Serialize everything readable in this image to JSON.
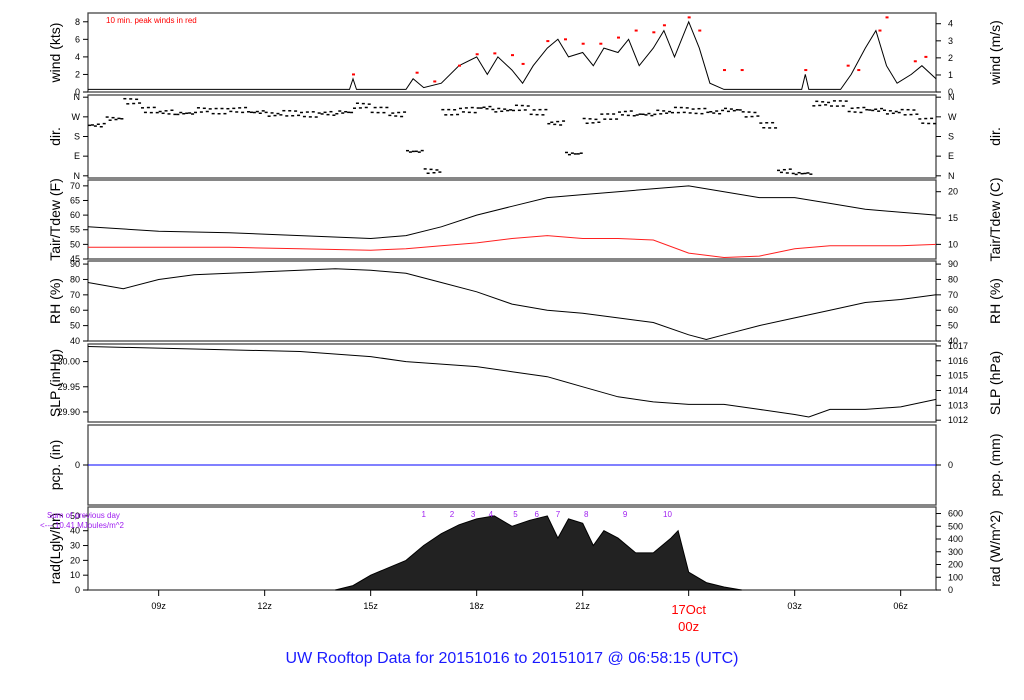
{
  "title": "UW Rooftop Data for 20151016  to  20151017 @ 06:58:15  (UTC)",
  "colors": {
    "peak": "#ff0000",
    "dew": "#ff2020",
    "pcp": "#0000ff",
    "annot": "#a020f0",
    "date": "#ff0000"
  },
  "chart_data": {
    "type": "line",
    "x_range_hours": [
      7.0,
      31.0
    ],
    "x_ticks": [
      {
        "h": 9,
        "label": "09z"
      },
      {
        "h": 12,
        "label": "12z"
      },
      {
        "h": 15,
        "label": "15z"
      },
      {
        "h": 18,
        "label": "18z"
      },
      {
        "h": 21,
        "label": "21z"
      },
      {
        "h": 24,
        "label": "00z"
      },
      {
        "h": 27,
        "label": "03z"
      },
      {
        "h": 30,
        "label": "06z"
      }
    ],
    "date_label": "17Oct",
    "panels": [
      {
        "id": "wind",
        "ylabel": "wind (kts)",
        "ylabel2": "wind (m/s)",
        "ylim": [
          0,
          9
        ],
        "ticks": [
          0,
          2,
          4,
          6,
          8
        ],
        "ticks2": [
          {
            "v": 0,
            "l": "0"
          },
          {
            "v": 1.94,
            "l": "1"
          },
          {
            "v": 3.89,
            "l": "2"
          },
          {
            "v": 5.83,
            "l": "3"
          },
          {
            "v": 7.78,
            "l": "4"
          }
        ],
        "annotation": "10 min. peak winds in red",
        "x": [
          7,
          14.4,
          14.5,
          14.6,
          16,
          16.2,
          16.5,
          17,
          17.5,
          18,
          18.3,
          18.6,
          19,
          19.3,
          19.6,
          20,
          20.3,
          20.6,
          21,
          21.3,
          21.6,
          22,
          22.3,
          22.6,
          23,
          23.3,
          23.6,
          24,
          24.3,
          24.6,
          25,
          27.2,
          27.3,
          27.4,
          28.3,
          28.6,
          29,
          29.3,
          29.6,
          29.9,
          30.3,
          30.6,
          31
        ],
        "values": [
          0.3,
          0.3,
          1.5,
          0.3,
          0.3,
          1.5,
          0.5,
          1,
          3,
          4,
          2,
          4,
          2.5,
          1,
          3,
          5,
          6,
          4,
          4.5,
          3,
          5,
          4.5,
          6,
          3,
          5,
          7,
          4,
          8,
          5,
          1,
          0.3,
          0.3,
          2,
          0.3,
          0.3,
          2,
          5,
          7,
          3,
          1,
          2,
          3,
          1.5
        ],
        "peaks": [
          [
            14.5,
            2
          ],
          [
            16.3,
            2.2
          ],
          [
            16.8,
            1.2
          ],
          [
            17.5,
            3
          ],
          [
            18,
            4.3
          ],
          [
            18.5,
            4.4
          ],
          [
            19,
            4.2
          ],
          [
            19.3,
            3.2
          ],
          [
            20,
            5.8
          ],
          [
            20.5,
            6
          ],
          [
            21,
            5.5
          ],
          [
            21.5,
            5.5
          ],
          [
            22,
            6.2
          ],
          [
            22.5,
            7
          ],
          [
            23,
            6.8
          ],
          [
            23.3,
            7.6
          ],
          [
            24,
            8.5
          ],
          [
            24.3,
            7
          ],
          [
            25,
            2.5
          ],
          [
            25.5,
            2.5
          ],
          [
            27.3,
            2.5
          ],
          [
            28.5,
            3
          ],
          [
            28.8,
            2.5
          ],
          [
            29.4,
            7
          ],
          [
            29.6,
            8.5
          ],
          [
            30.4,
            3.5
          ],
          [
            30.7,
            4
          ]
        ]
      },
      {
        "id": "dir",
        "ylabel": "dir.",
        "ylabel2": "dir.",
        "ylim": [
          -10,
          370
        ],
        "ticks2": [
          {
            "v": 0,
            "l": "N"
          },
          {
            "v": 90,
            "l": "E"
          },
          {
            "v": 180,
            "l": "S"
          },
          {
            "v": 270,
            "l": "W"
          },
          {
            "v": 360,
            "l": "N"
          }
        ],
        "x": [
          7,
          7.5,
          8,
          8.5,
          9,
          9.5,
          10,
          10.5,
          11,
          11.5,
          12,
          12.5,
          13,
          13.5,
          14,
          14.5,
          15,
          15.5,
          16,
          16.5,
          17,
          17.5,
          18,
          18.5,
          19,
          19.5,
          20,
          20.5,
          21,
          21.5,
          22,
          22.5,
          23,
          23.5,
          24,
          24.5,
          25,
          25.5,
          26,
          26.5,
          27,
          27.5,
          28,
          28.5,
          29,
          29.5,
          30,
          30.5,
          31
        ],
        "values": [
          230,
          260,
          340,
          300,
          290,
          285,
          300,
          295,
          300,
          290,
          280,
          285,
          280,
          285,
          290,
          320,
          300,
          280,
          110,
          20,
          290,
          300,
          310,
          300,
          310,
          290,
          240,
          100,
          250,
          270,
          285,
          280,
          290,
          300,
          295,
          290,
          300,
          280,
          230,
          20,
          10,
          330,
          330,
          300,
          300,
          290,
          290,
          250,
          120
        ]
      },
      {
        "id": "temp",
        "ylabel": "Tair/Tdew (F)",
        "ylabel2": "Tair/Tdew (C)",
        "ylim": [
          45,
          72
        ],
        "ticks": [
          45,
          50,
          55,
          60,
          65,
          70
        ],
        "ticks2": [
          {
            "v": 50,
            "l": "10"
          },
          {
            "v": 59,
            "l": "15"
          },
          {
            "v": 68,
            "l": "20"
          }
        ],
        "x": [
          7,
          9,
          11,
          13,
          15,
          16,
          17,
          18,
          19,
          20,
          21,
          22,
          23,
          24,
          25,
          26,
          27,
          28,
          29,
          30,
          31
        ],
        "series": [
          {
            "name": "Tair",
            "values": [
              56,
              54.5,
              54,
              53,
              52,
              53,
              56,
              60,
              63,
              66,
              67,
              68,
              69,
              70,
              68,
              66,
              66,
              64,
              62,
              61,
              60
            ]
          },
          {
            "name": "Tdew",
            "values": [
              49,
              49,
              49,
              48.5,
              48,
              48.5,
              49.5,
              50.5,
              52,
              53,
              52,
              52,
              51.5,
              47,
              45.5,
              46,
              48.5,
              49.5,
              49.5,
              49.5,
              50
            ]
          }
        ]
      },
      {
        "id": "rh",
        "ylabel": "RH (%)",
        "ylabel2": "RH (%)",
        "ylim": [
          40,
          92
        ],
        "ticks": [
          40,
          50,
          60,
          70,
          80,
          90
        ],
        "ticks2": [
          {
            "v": 40,
            "l": "40"
          },
          {
            "v": 50,
            "l": "50"
          },
          {
            "v": 60,
            "l": "60"
          },
          {
            "v": 70,
            "l": "70"
          },
          {
            "v": 80,
            "l": "80"
          },
          {
            "v": 90,
            "l": "90"
          }
        ],
        "x": [
          7,
          8,
          9,
          10,
          11,
          12,
          13,
          14,
          15,
          16,
          17,
          18,
          19,
          20,
          21,
          22,
          23,
          24,
          24.5,
          25,
          26,
          27,
          28,
          29,
          30,
          31
        ],
        "values": [
          78,
          74,
          80,
          83,
          84,
          85,
          86,
          87,
          86,
          84,
          78,
          72,
          64,
          60,
          58,
          55,
          52,
          44,
          41,
          44,
          50,
          55,
          60,
          65,
          67,
          70
        ]
      },
      {
        "id": "slp",
        "ylabel": "SLP (inHg)",
        "ylabel2": "SLP (hPa)",
        "ylim": [
          29.88,
          30.035
        ],
        "ticks": [
          {
            "v": 29.9,
            "l": "29.90"
          },
          {
            "v": 29.95,
            "l": "29.95"
          },
          {
            "v": 30.0,
            "l": "30.00"
          }
        ],
        "ticks2": [
          {
            "v": 29.8836,
            "l": "1012"
          },
          {
            "v": 29.9131,
            "l": "1013"
          },
          {
            "v": 29.9426,
            "l": "1014"
          },
          {
            "v": 29.9722,
            "l": "1015"
          },
          {
            "v": 30.0017,
            "l": "1016"
          },
          {
            "v": 30.0312,
            "l": "1017"
          }
        ],
        "x": [
          7,
          10,
          13,
          15,
          16,
          18,
          19,
          20,
          21,
          22,
          23,
          24,
          25,
          26,
          27,
          27.4,
          28,
          29,
          30,
          31
        ],
        "values": [
          30.03,
          30.025,
          30.02,
          30.01,
          30.0,
          29.99,
          29.98,
          29.97,
          29.95,
          29.93,
          29.92,
          29.915,
          29.915,
          29.905,
          29.895,
          29.89,
          29.905,
          29.905,
          29.91,
          29.925
        ]
      },
      {
        "id": "pcp",
        "ylabel": "pcp. (in)",
        "ylabel2": "pcp. (mm)",
        "ylim": [
          -1,
          1
        ],
        "ticks": [
          {
            "v": 0,
            "l": "0"
          }
        ],
        "ticks2": [
          {
            "v": 0,
            "l": "0"
          }
        ],
        "x": [
          7,
          31
        ],
        "values": [
          0,
          0
        ]
      },
      {
        "id": "rad",
        "ylabel": "rad(Lgly/hr)",
        "ylabel2": "rad (W/m^2)",
        "ylim": [
          0,
          56
        ],
        "ticks": [
          0,
          10,
          20,
          30,
          40,
          50
        ],
        "ticks2": [
          {
            "v": 0,
            "l": "0"
          },
          {
            "v": 8.6,
            "l": "100"
          },
          {
            "v": 17.2,
            "l": "200"
          },
          {
            "v": 25.8,
            "l": "300"
          },
          {
            "v": 34.4,
            "l": "400"
          },
          {
            "v": 43,
            "l": "500"
          },
          {
            "v": 51.6,
            "l": "600"
          }
        ],
        "annotation1": "Sum of previous day",
        "annotation2": "<--- 10.41 MJoules/m^2",
        "hour_marks": [
          {
            "h": 16.5,
            "l": "1"
          },
          {
            "h": 17.3,
            "l": "2"
          },
          {
            "h": 17.9,
            "l": "3"
          },
          {
            "h": 18.4,
            "l": "4"
          },
          {
            "h": 19.1,
            "l": "5"
          },
          {
            "h": 19.7,
            "l": "6"
          },
          {
            "h": 20.3,
            "l": "7"
          },
          {
            "h": 21.1,
            "l": "8"
          },
          {
            "h": 22.2,
            "l": "9"
          },
          {
            "h": 23.4,
            "l": "10"
          }
        ],
        "x": [
          14,
          14.5,
          15,
          15.5,
          16,
          16.5,
          17,
          17.5,
          18,
          18.5,
          19,
          19.5,
          20,
          20.3,
          20.6,
          21,
          21.3,
          21.6,
          22,
          22.5,
          23,
          23.5,
          23.7,
          24,
          24.5,
          25,
          25.5
        ],
        "values": [
          0,
          3,
          10,
          15,
          20,
          30,
          38,
          44,
          48,
          50,
          43,
          47,
          50,
          35,
          48,
          45,
          30,
          40,
          35,
          25,
          25,
          35,
          40,
          12,
          5,
          2,
          0
        ]
      }
    ]
  }
}
